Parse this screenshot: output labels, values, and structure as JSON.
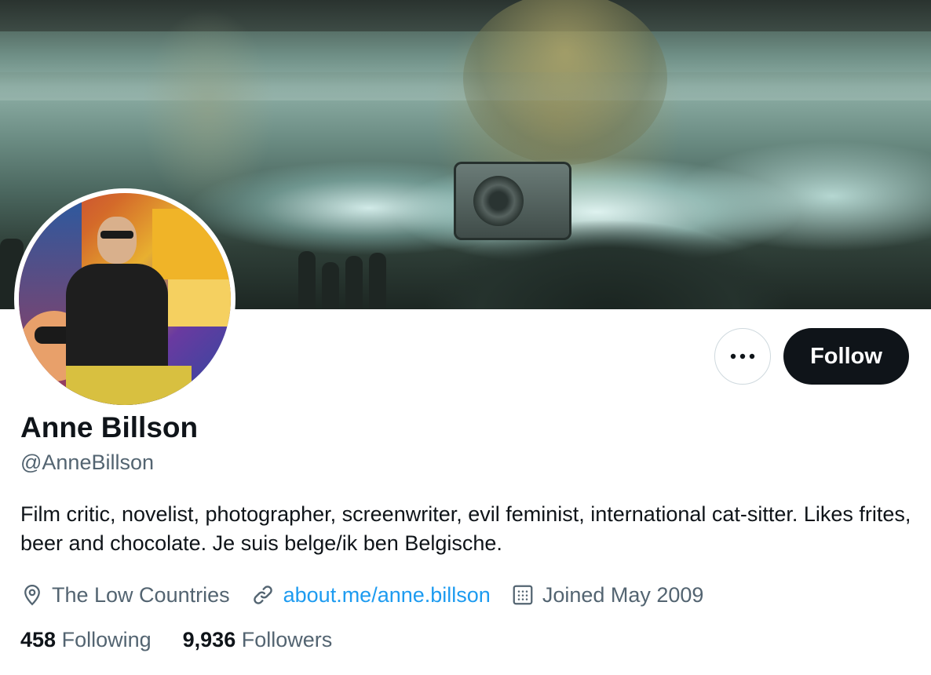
{
  "profile": {
    "name": "Anne Billson",
    "handle": "@AnneBillson",
    "bio": "Film critic, novelist, photographer, screenwriter, evil feminist, international cat-sitter. Likes frites, beer and chocolate. Je suis belge/ik ben Belgische.",
    "location": "The Low Countries",
    "website": "about.me/anne.billson",
    "joined": "Joined May 2009"
  },
  "actions": {
    "more_icon": "ellipsis-icon",
    "follow_label": "Follow"
  },
  "stats": {
    "following_count": "458",
    "following_label": "Following",
    "followers_count": "9,936",
    "followers_label": "Followers"
  },
  "icons": {
    "location": "location-pin-icon",
    "website": "link-icon",
    "joined": "calendar-icon"
  },
  "colors": {
    "text_primary": "#0f1419",
    "text_secondary": "#536471",
    "link": "#1d9bf0",
    "follow_button_bg": "#0f1419"
  }
}
